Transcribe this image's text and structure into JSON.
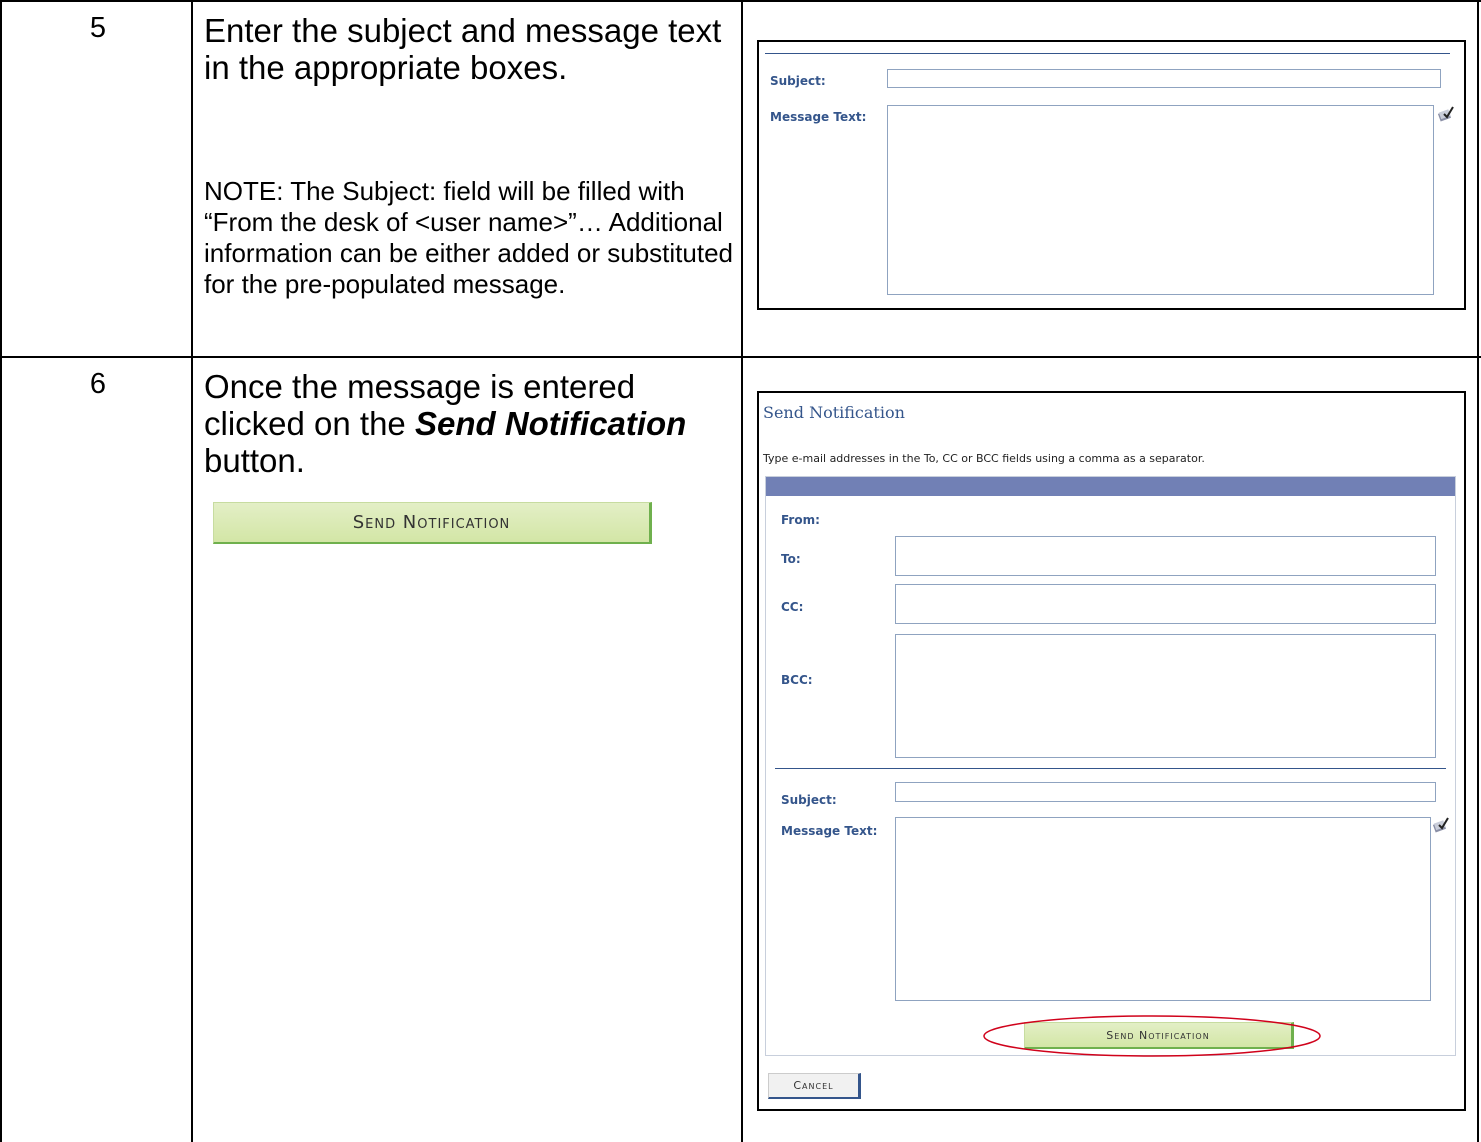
{
  "steps": [
    {
      "number": "5",
      "instruction": "Enter the subject and message text in the appropriate boxes.",
      "note": "NOTE:  The Subject: field will be filled with “From the desk of <user name>”… Additional information can be either added or substituted for the pre-populated message."
    },
    {
      "number": "6",
      "instruction_part1": "Once the message is entered clicked on the ",
      "instruction_bold": "Send Notification",
      "instruction_part2": " button.",
      "button_label": "Send Notification"
    }
  ],
  "shot1": {
    "subject_label": "Subject:",
    "message_label": "Message Text:"
  },
  "shot2": {
    "title": "Send Notification",
    "instructions": "Type e-mail addresses in the To, CC or BCC fields using a comma as a separator.",
    "from_label": "From:",
    "to_label": "To:",
    "cc_label": "CC:",
    "bcc_label": "BCC:",
    "subject_label": "Subject:",
    "message_label": "Message Text:",
    "send_button": "Send Notification",
    "cancel_button": "Cancel"
  },
  "colors": {
    "label_blue": "#34558b",
    "header_bar": "#7180b5",
    "button_green": "#d3e6a6",
    "highlight_red": "#d0021b"
  },
  "icons": [
    "spell-check-icon"
  ]
}
